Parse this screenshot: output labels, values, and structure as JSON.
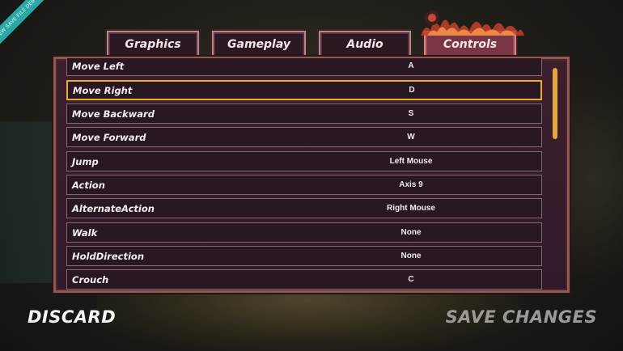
{
  "badge": {
    "text": "NEW SAVE FILE DEBUG"
  },
  "tabs": [
    {
      "label": "Graphics",
      "active": false
    },
    {
      "label": "Gameplay",
      "active": false
    },
    {
      "label": "Audio",
      "active": false
    },
    {
      "label": "Controls",
      "active": true
    }
  ],
  "bindings": [
    {
      "action": "Move Left",
      "key": "A"
    },
    {
      "action": "Move Right",
      "key": "D",
      "selected": true
    },
    {
      "action": "Move Backward",
      "key": "S"
    },
    {
      "action": "Move Forward",
      "key": "W"
    },
    {
      "action": "Jump",
      "key": "Left Mouse"
    },
    {
      "action": "Action",
      "key": "Axis 9"
    },
    {
      "action": "AlternateAction",
      "key": "Right Mouse"
    },
    {
      "action": "Walk",
      "key": "None"
    },
    {
      "action": "HoldDirection",
      "key": "None"
    },
    {
      "action": "Crouch",
      "key": "C"
    }
  ],
  "footer": {
    "discard_label": "DISCARD",
    "save_label": "SAVE CHANGES"
  },
  "colors": {
    "accent": "#e2b224",
    "panel": "#3d1f2c",
    "active_tab": "#7a3644",
    "scroll": "#e2a83c"
  },
  "scroll_position_fraction": 0.0
}
